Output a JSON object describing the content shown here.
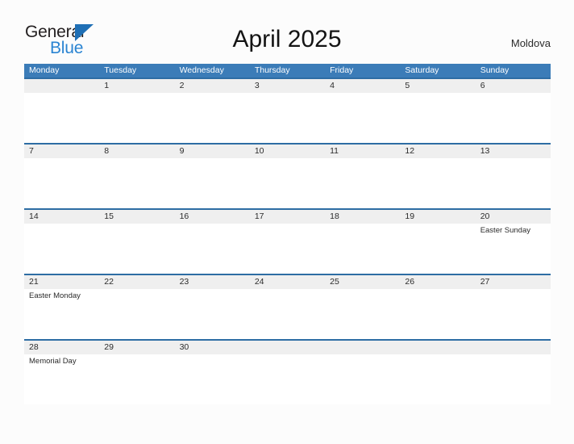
{
  "brand": {
    "name_part1": "General",
    "name_part2": "Blue",
    "triangle_color": "#1f6fb5",
    "blue_text_color": "#2a84d2"
  },
  "header": {
    "title": "April 2025",
    "region": "Moldova"
  },
  "colors": {
    "header_blue": "#3b7cb8",
    "row_divider_blue": "#2e6da4",
    "band_gray": "#efefef",
    "page_background": "#fcfcfc"
  },
  "weekdays": [
    "Monday",
    "Tuesday",
    "Wednesday",
    "Thursday",
    "Friday",
    "Saturday",
    "Sunday"
  ],
  "weeks": [
    {
      "days": [
        {
          "num": "",
          "event": ""
        },
        {
          "num": "1",
          "event": ""
        },
        {
          "num": "2",
          "event": ""
        },
        {
          "num": "3",
          "event": ""
        },
        {
          "num": "4",
          "event": ""
        },
        {
          "num": "5",
          "event": ""
        },
        {
          "num": "6",
          "event": ""
        }
      ]
    },
    {
      "days": [
        {
          "num": "7",
          "event": ""
        },
        {
          "num": "8",
          "event": ""
        },
        {
          "num": "9",
          "event": ""
        },
        {
          "num": "10",
          "event": ""
        },
        {
          "num": "11",
          "event": ""
        },
        {
          "num": "12",
          "event": ""
        },
        {
          "num": "13",
          "event": ""
        }
      ]
    },
    {
      "days": [
        {
          "num": "14",
          "event": ""
        },
        {
          "num": "15",
          "event": ""
        },
        {
          "num": "16",
          "event": ""
        },
        {
          "num": "17",
          "event": ""
        },
        {
          "num": "18",
          "event": ""
        },
        {
          "num": "19",
          "event": ""
        },
        {
          "num": "20",
          "event": "Easter Sunday"
        }
      ]
    },
    {
      "days": [
        {
          "num": "21",
          "event": "Easter Monday"
        },
        {
          "num": "22",
          "event": ""
        },
        {
          "num": "23",
          "event": ""
        },
        {
          "num": "24",
          "event": ""
        },
        {
          "num": "25",
          "event": ""
        },
        {
          "num": "26",
          "event": ""
        },
        {
          "num": "27",
          "event": ""
        }
      ]
    },
    {
      "days": [
        {
          "num": "28",
          "event": "Memorial Day"
        },
        {
          "num": "29",
          "event": ""
        },
        {
          "num": "30",
          "event": ""
        },
        {
          "num": "",
          "event": ""
        },
        {
          "num": "",
          "event": ""
        },
        {
          "num": "",
          "event": ""
        },
        {
          "num": "",
          "event": ""
        }
      ]
    }
  ]
}
